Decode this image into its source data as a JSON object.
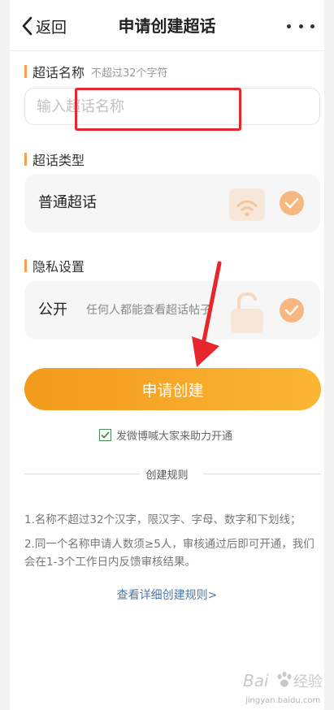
{
  "header": {
    "back_label": "返回",
    "title": "申请创建超话"
  },
  "name_section": {
    "label": "超话名称",
    "hint": "不超过32个字符",
    "placeholder": "输入超话名称"
  },
  "type_section": {
    "label": "超话类型",
    "option": "普通超话"
  },
  "privacy_section": {
    "label": "隐私设置",
    "option": "公开",
    "description": "任何人都能查看超话帖子"
  },
  "submit_label": "申请创建",
  "agreement": {
    "checked": true,
    "text": "发微博喊大家来助力开通"
  },
  "rules": {
    "title": "创建规则",
    "items": [
      "1.名称不超过32个汉字，限汉字、字母、数字和下划线；",
      "2.同一个名称申请人数须≥5人，审核通过后即可开通，我们会在1-3个工作日内反馈审核结果。"
    ],
    "detail_link": "查看详细创建规则>"
  },
  "watermark": {
    "site": "jingyan.baidu.com"
  },
  "colors": {
    "accent": "#f6a04d",
    "button_start": "#f39a1c",
    "button_end": "#fbb535",
    "check": "#f6b780",
    "highlight_red": "#e8272d",
    "link": "#4d79a8"
  }
}
